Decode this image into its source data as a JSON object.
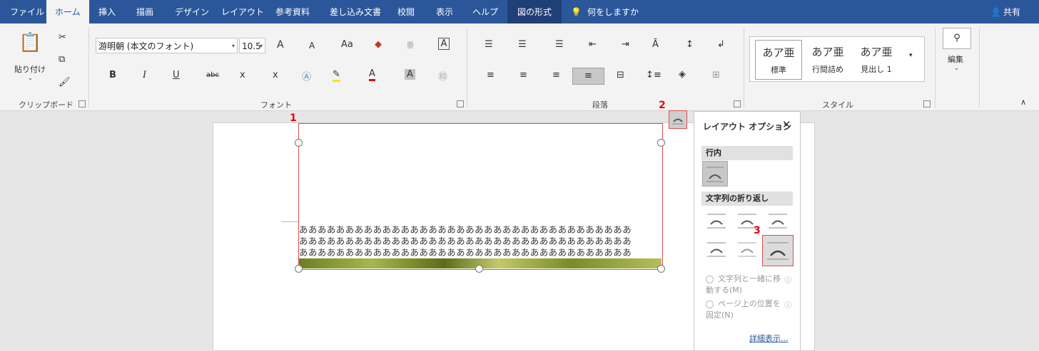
{
  "tabs": {
    "file": "ファイル",
    "home": "ホーム",
    "insert": "挿入",
    "draw": "描画",
    "design": "デザイン",
    "layout": "レイアウト",
    "references": "参考資料",
    "mailings": "差し込み文書",
    "review": "校閲",
    "view": "表示",
    "help": "ヘルプ",
    "format": "図の形式",
    "tell_me": "何をしますか",
    "share": "共有"
  },
  "ribbon": {
    "clipboard": {
      "paste_label": "貼り付け",
      "group_label": "クリップボード"
    },
    "font": {
      "font_name": "游明朝 (本文のフォント)",
      "font_size": "10.5",
      "group_label": "フォント",
      "grow_icon": "A",
      "shrink_icon": "A",
      "case_icon": "Aa",
      "bold": "B",
      "italic": "I",
      "underline": "U",
      "strike": "abc",
      "subscript": "x",
      "superscript": "x",
      "font_color": "A",
      "char_shade": "A",
      "ruby_glyph": "亜",
      "box_glyph": "A"
    },
    "paragraph": {
      "group_label": "段落"
    },
    "styles": {
      "group_label": "スタイル",
      "items": [
        {
          "preview": "あア亜",
          "name": "標準"
        },
        {
          "preview": "あア亜",
          "name": "行間詰め"
        },
        {
          "preview": "あア亜",
          "name": "見出し 1"
        }
      ]
    },
    "editing": {
      "label": "編集"
    }
  },
  "document": {
    "text_line": "ああああああああああああああああああああああああああああああああああああ",
    "colors": {
      "accent": "#2b579a",
      "selection": "#e24a4a"
    }
  },
  "annotations": {
    "one": "1",
    "two": "2",
    "three": "3"
  },
  "layout_panel": {
    "title": "レイアウト オプション",
    "close": "✕",
    "inline_section": "行内",
    "wrap_section": "文字列の折り返し",
    "move_with_text": "文字列と一緒に移動する(M)",
    "fix_position": "ページ上の位置を固定(N)",
    "see_more": "詳細表示..."
  }
}
